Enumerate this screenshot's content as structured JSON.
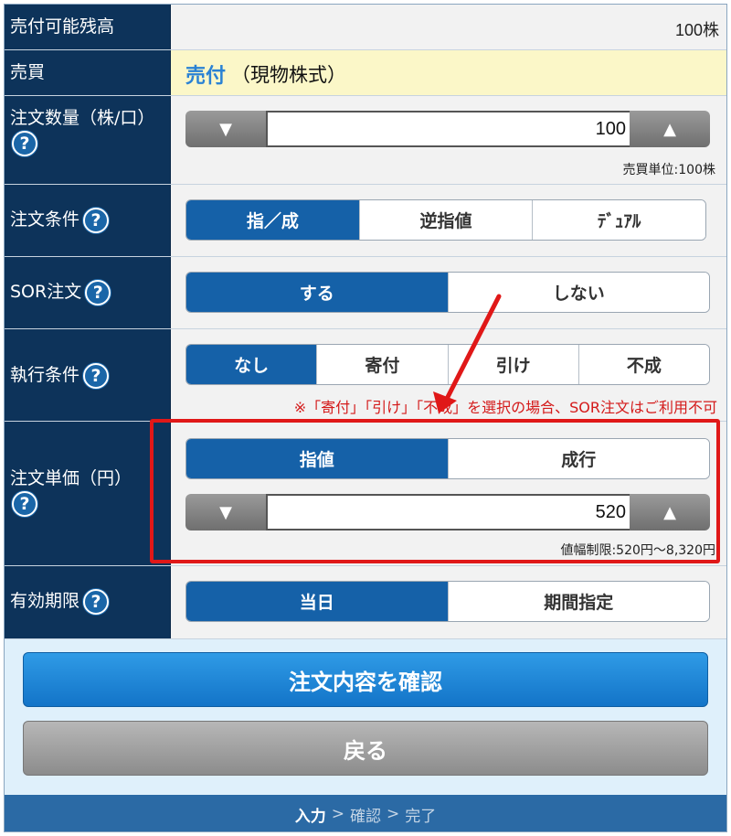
{
  "colors": {
    "header_bg": "#0d335a",
    "active": "#1561a8",
    "annotation": "#e01818",
    "confirm": "#1f86d6",
    "footer": "#2b6aa5"
  },
  "available": {
    "label": "売付可能残高",
    "value": "100株"
  },
  "trade": {
    "label": "売買",
    "type": "売付",
    "detail": "（現物株式）"
  },
  "quantity": {
    "label": "注文数量（株/口）",
    "help": "?",
    "value": "100",
    "dec": "▼",
    "inc": "▲",
    "unit_note": "売買単位:100株"
  },
  "condition": {
    "label": "注文条件",
    "help": "?",
    "options": [
      "指／成",
      "逆指値",
      "ﾃﾞｭｱﾙ"
    ],
    "selected": "指／成"
  },
  "sor": {
    "label": "SOR注文",
    "help": "?",
    "options": [
      "する",
      "しない"
    ],
    "selected": "する"
  },
  "execution": {
    "label": "執行条件",
    "help": "?",
    "options": [
      "なし",
      "寄付",
      "引け",
      "不成"
    ],
    "selected": "なし",
    "note": "※「寄付」「引け」「不成」を選択の場合、SOR注文はご利用不可"
  },
  "price": {
    "label": "注文単価（円）",
    "help": "?",
    "options": [
      "指値",
      "成行"
    ],
    "selected": "指値",
    "value": "520",
    "dec": "▼",
    "inc": "▲",
    "limit_note": "値幅制限:520円〜8,320円"
  },
  "expiry": {
    "label": "有効期限",
    "help": "?",
    "options": [
      "当日",
      "期間指定"
    ],
    "selected": "当日"
  },
  "buttons": {
    "confirm": "注文内容を確認",
    "back": "戻る"
  },
  "steps": {
    "current": "入力",
    "sep": ">",
    "next": "確認",
    "last": "完了"
  }
}
